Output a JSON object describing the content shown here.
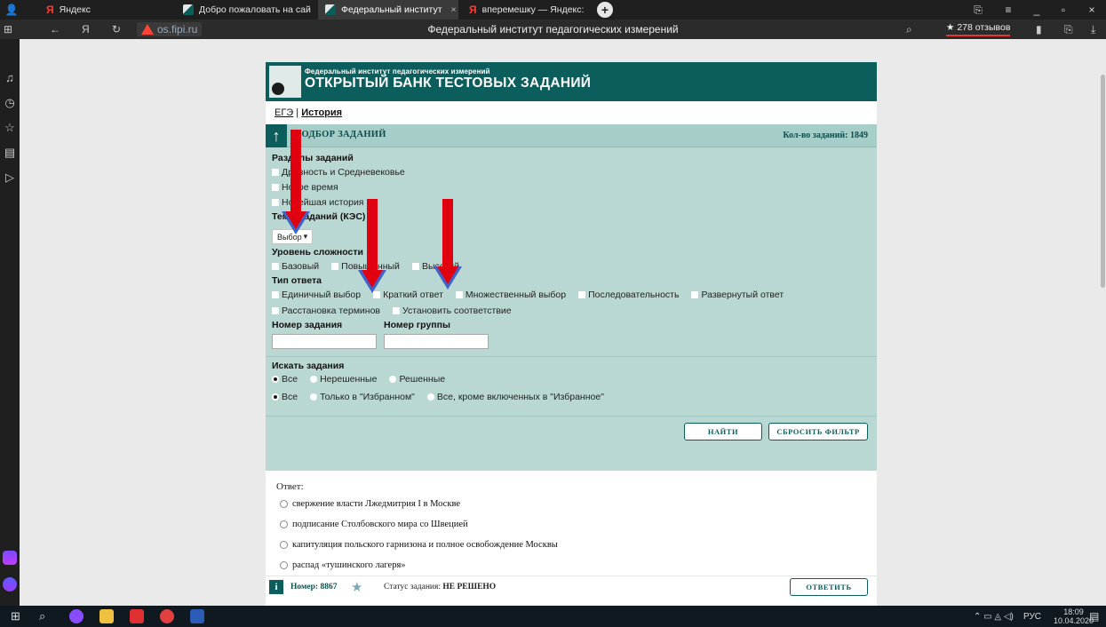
{
  "browser": {
    "tabs": [
      {
        "label": "Яндекс",
        "active": false
      },
      {
        "label": "Добро пожаловать на сай",
        "active": false
      },
      {
        "label": "Федеральный институт",
        "active": true
      },
      {
        "label": "вперемешку — Яндекс: н",
        "active": false
      }
    ],
    "url": "os.fipi.ru",
    "page_title": "Федеральный институт педагогических измерений",
    "reviews": "★ 278 отзывов"
  },
  "site": {
    "header_subtitle": "Федеральный институт педагогических измерений",
    "header_title": "ОТКРЫТЫЙ БАНК ТЕСТОВЫХ ЗАДАНИЙ",
    "breadcrumb": {
      "root": "ЕГЭ",
      "separator": "|",
      "current": "История"
    }
  },
  "filter": {
    "title": "ПОДБОР ЗАДАНИЙ",
    "count": "Кол-во заданий: 1849",
    "sections_label": "Разделы заданий",
    "sections": [
      "Древность и Средневековье",
      "Новое время",
      "Новейшая история"
    ],
    "topics_label": "Темы заданий (КЭС)",
    "topics_select": "Выбор",
    "difficulty_label": "Уровень сложности",
    "difficulty": [
      "Базовый",
      "Повышенный",
      "Высокий"
    ],
    "answer_type_label": "Тип ответа",
    "answer_types_row1": [
      "Единичный выбор",
      "Краткий ответ",
      "Множественный выбор",
      "Последовательность",
      "Развернутый ответ"
    ],
    "answer_types_row2": [
      "Расстановка терминов",
      "Установить соответствие"
    ],
    "task_number_label": "Номер задания",
    "group_number_label": "Номер группы",
    "search_label": "Искать задания",
    "search_row1": [
      {
        "label": "Все",
        "checked": true
      },
      {
        "label": "Нерешенные",
        "checked": false
      },
      {
        "label": "Решенные",
        "checked": false
      }
    ],
    "search_row2": [
      {
        "label": "Все",
        "checked": true
      },
      {
        "label": "Только в \"Избранном\"",
        "checked": false
      },
      {
        "label": "Все, кроме включенных в \"Избранное\"",
        "checked": false
      }
    ],
    "find_button": "НАЙТИ",
    "reset_button": "СБРОСИТЬ ФИЛЬТР"
  },
  "answer": {
    "label": "Ответ:",
    "options": [
      "свержение власти Лжедмитрия I в Москве",
      "подписание Столбовского мира со Швецией",
      "капитуляция польского гарнизона и полное освобождение Москвы",
      "распад «тушинского лагеря»"
    ]
  },
  "task": {
    "info_icon": "i",
    "number": "Номер: 8867",
    "status_prefix": "Статус задания:",
    "status_value": "НЕ РЕШЕНО",
    "answer_button": "ОТВЕТИТЬ"
  },
  "taskbar": {
    "lang": "РУС",
    "time": "18:09",
    "date": "10.04.2020"
  },
  "colors": {
    "brand": "#0c5e5c",
    "filter_bg": "#b9d8d4",
    "annotation_arrow": "#e00010"
  }
}
